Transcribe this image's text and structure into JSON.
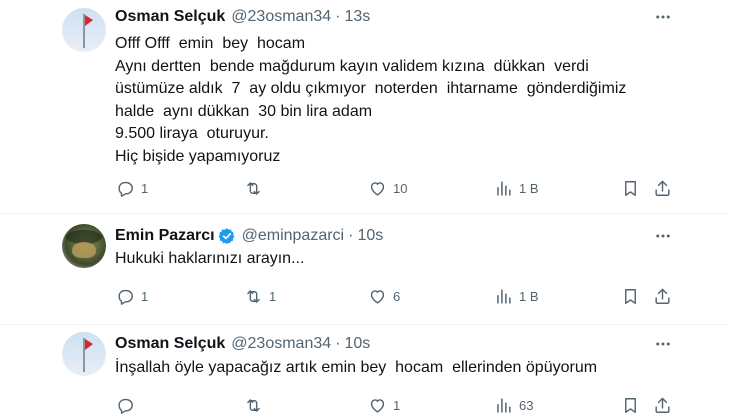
{
  "tweets": [
    {
      "name": "Osman Selçuk",
      "handle": "@23osman34",
      "dot": "·",
      "time": "13s",
      "text": "Offf Offf  emin  bey  hocam\nAynı dertten  bende mağdurum kayın validem kızına  dükkan  verdi\nüstümüze aldık  7  ay oldu çıkmıyor  noterden  ihtarname  gönderdiğimiz\nhalde  aynı dükkan  30 bin lira adam\n9.500 liraya  oturuyur.\nHiç bişide yapamıyoruz",
      "replies": "1",
      "retweets": "",
      "likes": "10",
      "views": "1 B"
    },
    {
      "name": "Emin Pazarcı",
      "handle": "@eminpazarci",
      "dot": "·",
      "time": "10s",
      "text": "Hukuki haklarınızı arayın...",
      "replies": "1",
      "retweets": "1",
      "likes": "6",
      "views": "1 B"
    },
    {
      "name": "Osman Selçuk",
      "handle": "@23osman34",
      "dot": "·",
      "time": "10s",
      "text": "İnşallah öyle yapacağız artık emin bey  hocam  ellerinden öpüyorum",
      "replies": "",
      "retweets": "",
      "likes": "1",
      "views": "63"
    }
  ],
  "icons": {
    "reply": "reply-icon",
    "retweet": "retweet-icon",
    "like": "heart-icon",
    "views": "views-icon",
    "bookmark": "bookmark-icon",
    "share": "share-icon",
    "more": "more-icon",
    "verified": "verified-badge-icon"
  },
  "colors": {
    "text": "#0f1419",
    "secondary": "#536471",
    "verified": "#1d9bf0"
  }
}
